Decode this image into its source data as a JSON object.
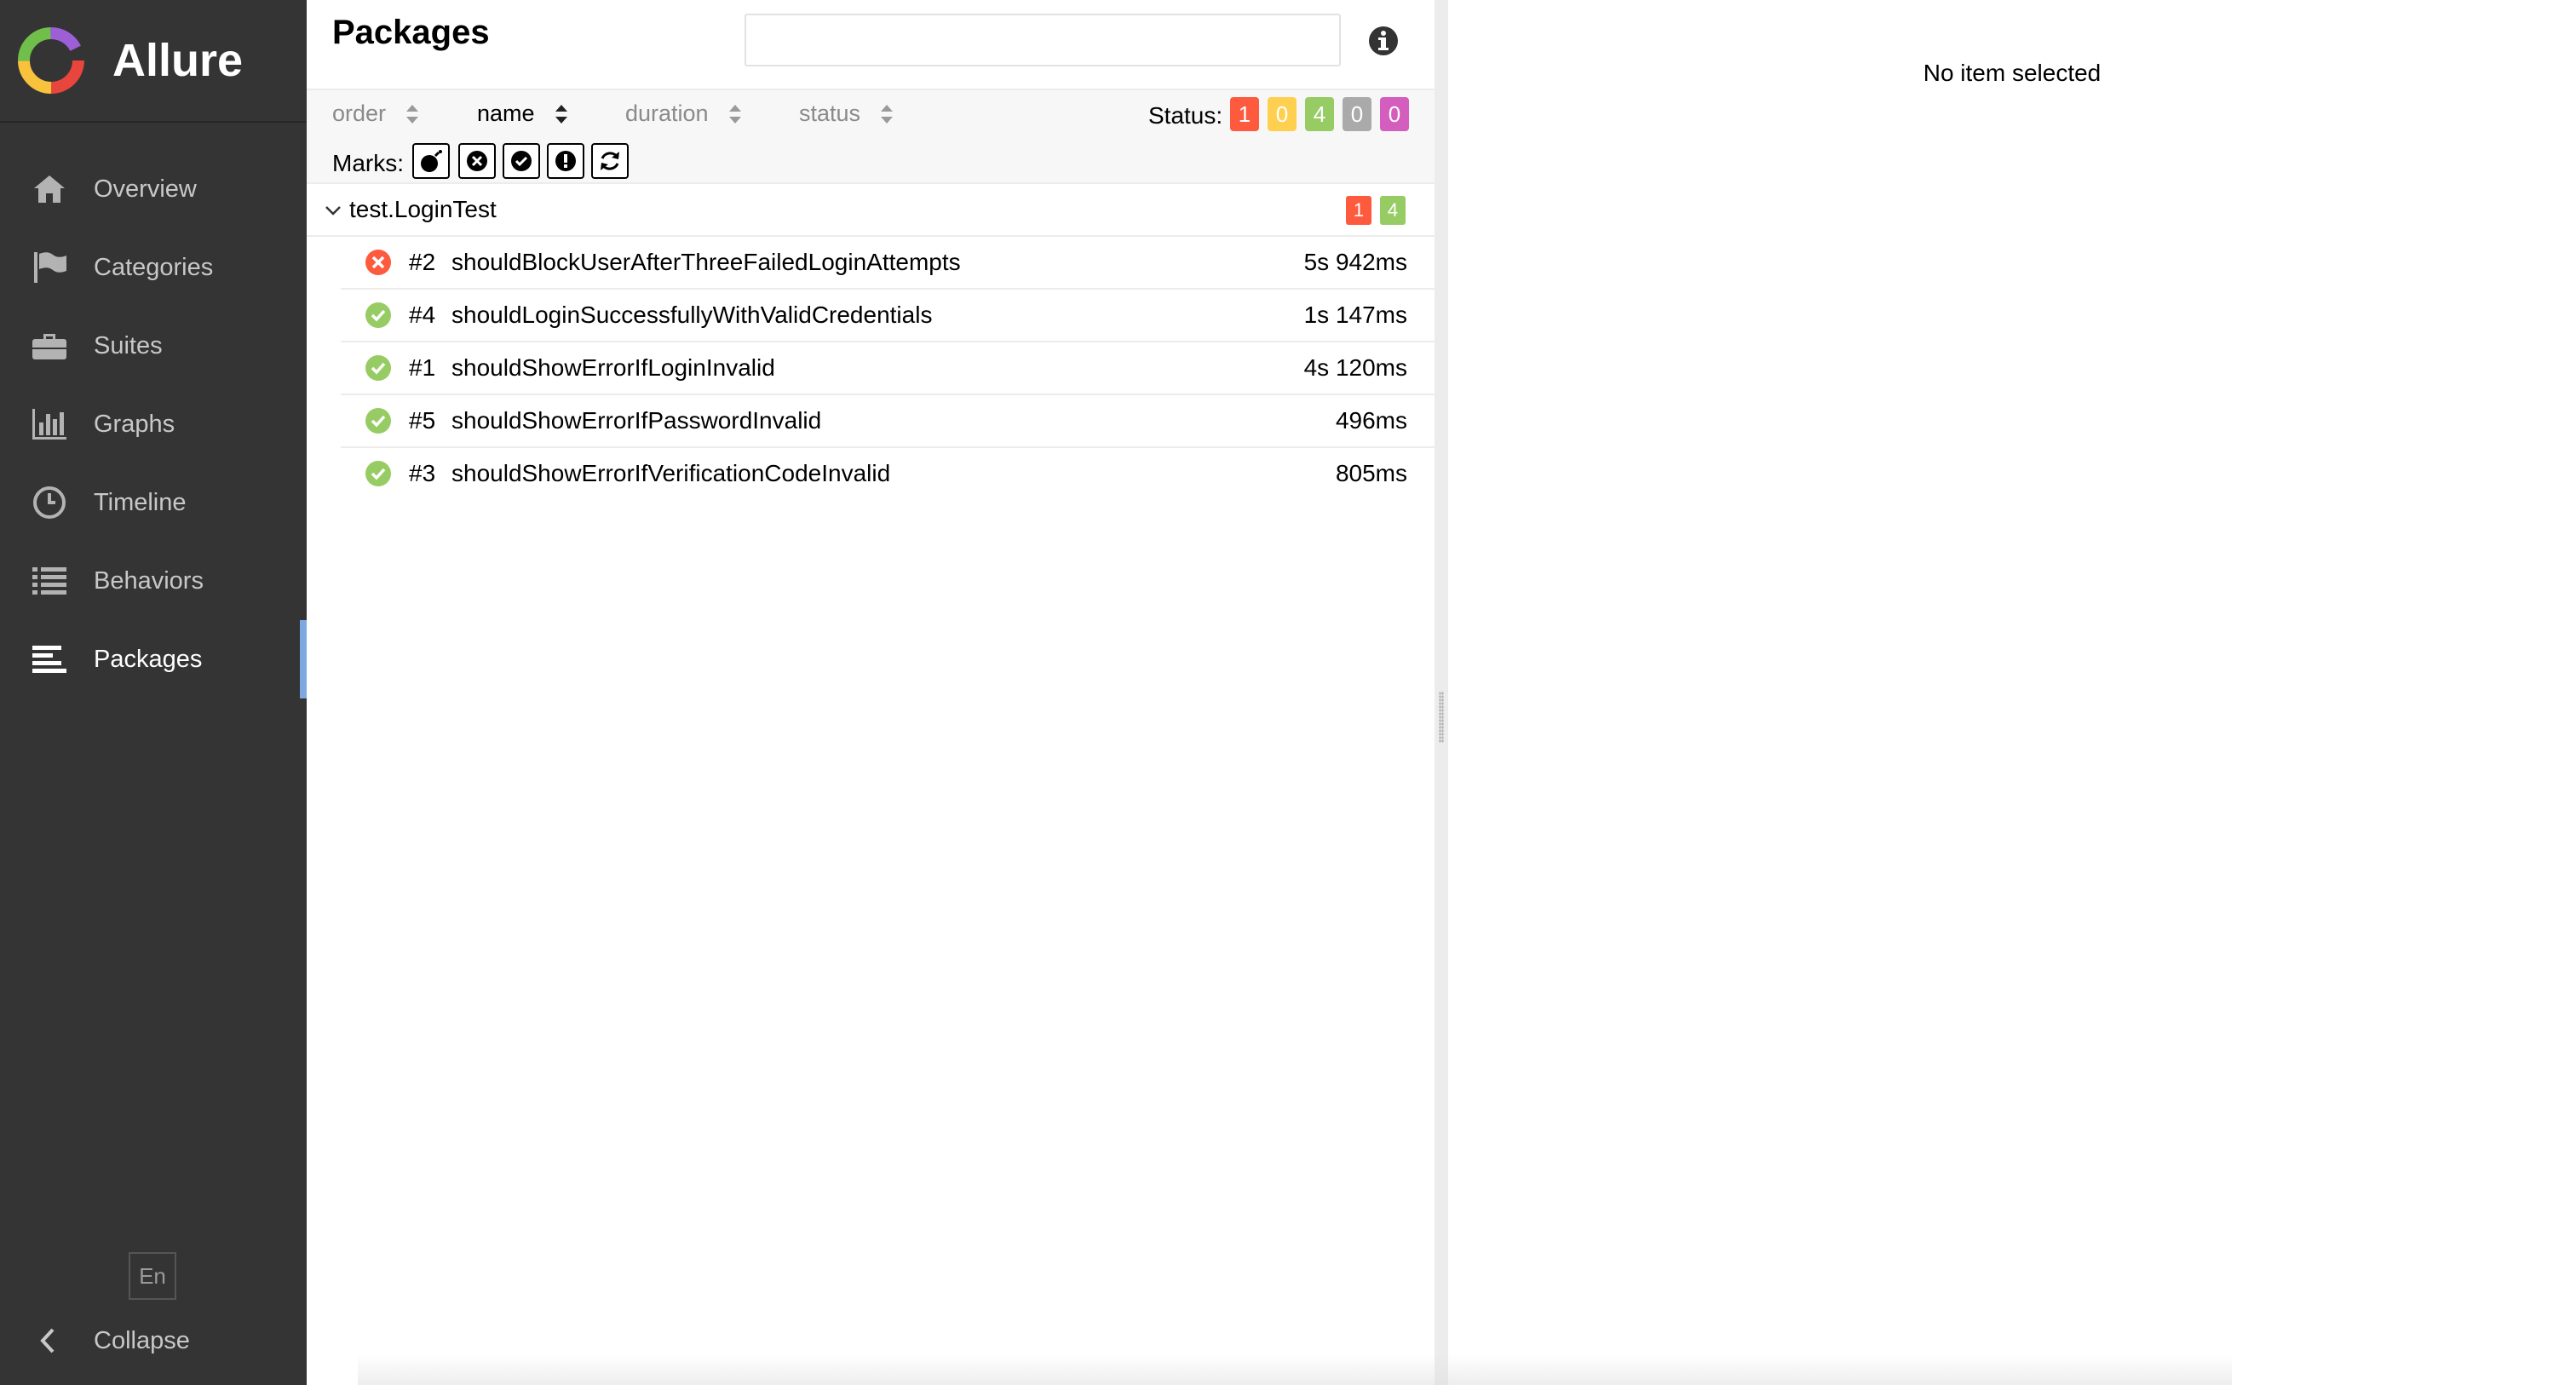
{
  "app": {
    "name": "Allure"
  },
  "sidebar": {
    "items": [
      {
        "label": "Overview",
        "icon": "home-icon"
      },
      {
        "label": "Categories",
        "icon": "flag-icon"
      },
      {
        "label": "Suites",
        "icon": "briefcase-icon"
      },
      {
        "label": "Graphs",
        "icon": "bar-chart-icon"
      },
      {
        "label": "Timeline",
        "icon": "clock-icon"
      },
      {
        "label": "Behaviors",
        "icon": "list-icon"
      },
      {
        "label": "Packages",
        "icon": "align-left-icon",
        "active": true
      }
    ],
    "language": "En",
    "collapse_label": "Collapse"
  },
  "packages": {
    "title": "Packages",
    "search": {
      "value": "",
      "placeholder": ""
    },
    "sort": [
      {
        "label": "order",
        "active": false
      },
      {
        "label": "name",
        "active": true
      },
      {
        "label": "duration",
        "active": false
      },
      {
        "label": "status",
        "active": false
      }
    ],
    "status_label": "Status:",
    "status_counts": [
      {
        "status": "failed",
        "count": "1",
        "color": "#fd5a3e"
      },
      {
        "status": "broken",
        "count": "0",
        "color": "#ffd050"
      },
      {
        "status": "passed",
        "count": "4",
        "color": "#97cc64"
      },
      {
        "status": "skipped",
        "count": "0",
        "color": "#aaaaaa"
      },
      {
        "status": "unknown",
        "count": "0",
        "color": "#d35ebe"
      }
    ],
    "marks_label": "Marks:",
    "marks": [
      "bomb-icon",
      "times-circle-icon",
      "check-circle-icon",
      "exclamation-circle-icon",
      "refresh-icon"
    ],
    "group": {
      "name": "test.LoginTest",
      "badges": [
        {
          "count": "1",
          "color": "#fd5a3e"
        },
        {
          "count": "4",
          "color": "#97cc64"
        }
      ]
    },
    "tests": [
      {
        "order": "#2",
        "name": "shouldBlockUserAfterThreeFailedLoginAttempts",
        "duration": "5s 942ms",
        "status": "failed"
      },
      {
        "order": "#4",
        "name": "shouldLoginSuccessfullyWithValidCredentials",
        "duration": "1s 147ms",
        "status": "passed"
      },
      {
        "order": "#1",
        "name": "shouldShowErrorIfLoginInvalid",
        "duration": "4s 120ms",
        "status": "passed"
      },
      {
        "order": "#5",
        "name": "shouldShowErrorIfPasswordInvalid",
        "duration": "496ms",
        "status": "passed"
      },
      {
        "order": "#3",
        "name": "shouldShowErrorIfVerificationCodeInvalid",
        "duration": "805ms",
        "status": "passed"
      }
    ]
  },
  "details": {
    "empty_message": "No item selected"
  },
  "colors": {
    "sidebar_bg": "#343434",
    "active_accent": "#7ea9e0",
    "failed": "#fd5a3e",
    "passed": "#97cc64"
  }
}
